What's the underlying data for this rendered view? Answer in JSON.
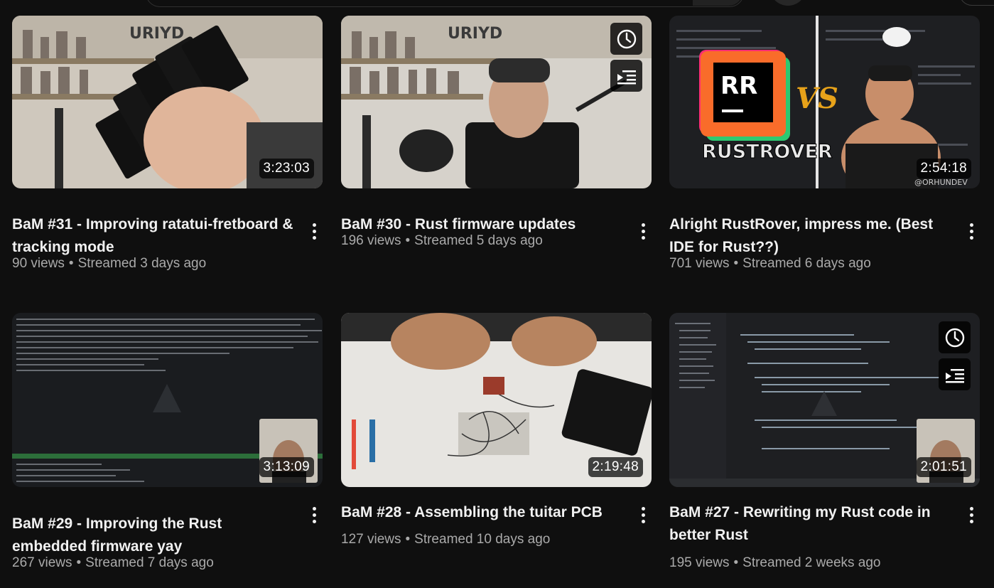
{
  "videos": [
    {
      "title": "BaM #31 - Improving ratatui-fretboard & tracking mode",
      "views": "90 views",
      "streamed": "Streamed 3 days ago",
      "duration": "3:23:03"
    },
    {
      "title": "BaM #30 - Rust firmware updates",
      "views": "196 views",
      "streamed": "Streamed 5 days ago",
      "duration": ""
    },
    {
      "title": "Alright RustRover, impress me. (Best IDE for Rust??)",
      "views": "701 views",
      "streamed": "Streamed 6 days ago",
      "duration": "2:54:18"
    },
    {
      "title": "BaM #29 - Improving the Rust embedded firmware yay",
      "views": "267 views",
      "streamed": "Streamed 7 days ago",
      "duration": "3:13:09"
    },
    {
      "title": "BaM #28 - Assembling the tuitar PCB",
      "views": "127 views",
      "streamed": "Streamed 10 days ago",
      "duration": "2:19:48"
    },
    {
      "title": "BaM #27 - Rewriting my Rust code in better Rust",
      "views": "195 views",
      "streamed": "Streamed 2 weeks ago",
      "duration": "2:01:51"
    }
  ],
  "thumb_text": {
    "logo": "URIYD",
    "rr_badge": "RR",
    "vs": "VS",
    "rustrover": "RUSTROVER",
    "watermark": "@ORHUNDEV"
  },
  "separator": "•",
  "colors": {
    "background": "#0f0f0f",
    "title": "#f1f1f1",
    "meta": "#aaaaaa",
    "badge_bg": "#000000"
  }
}
